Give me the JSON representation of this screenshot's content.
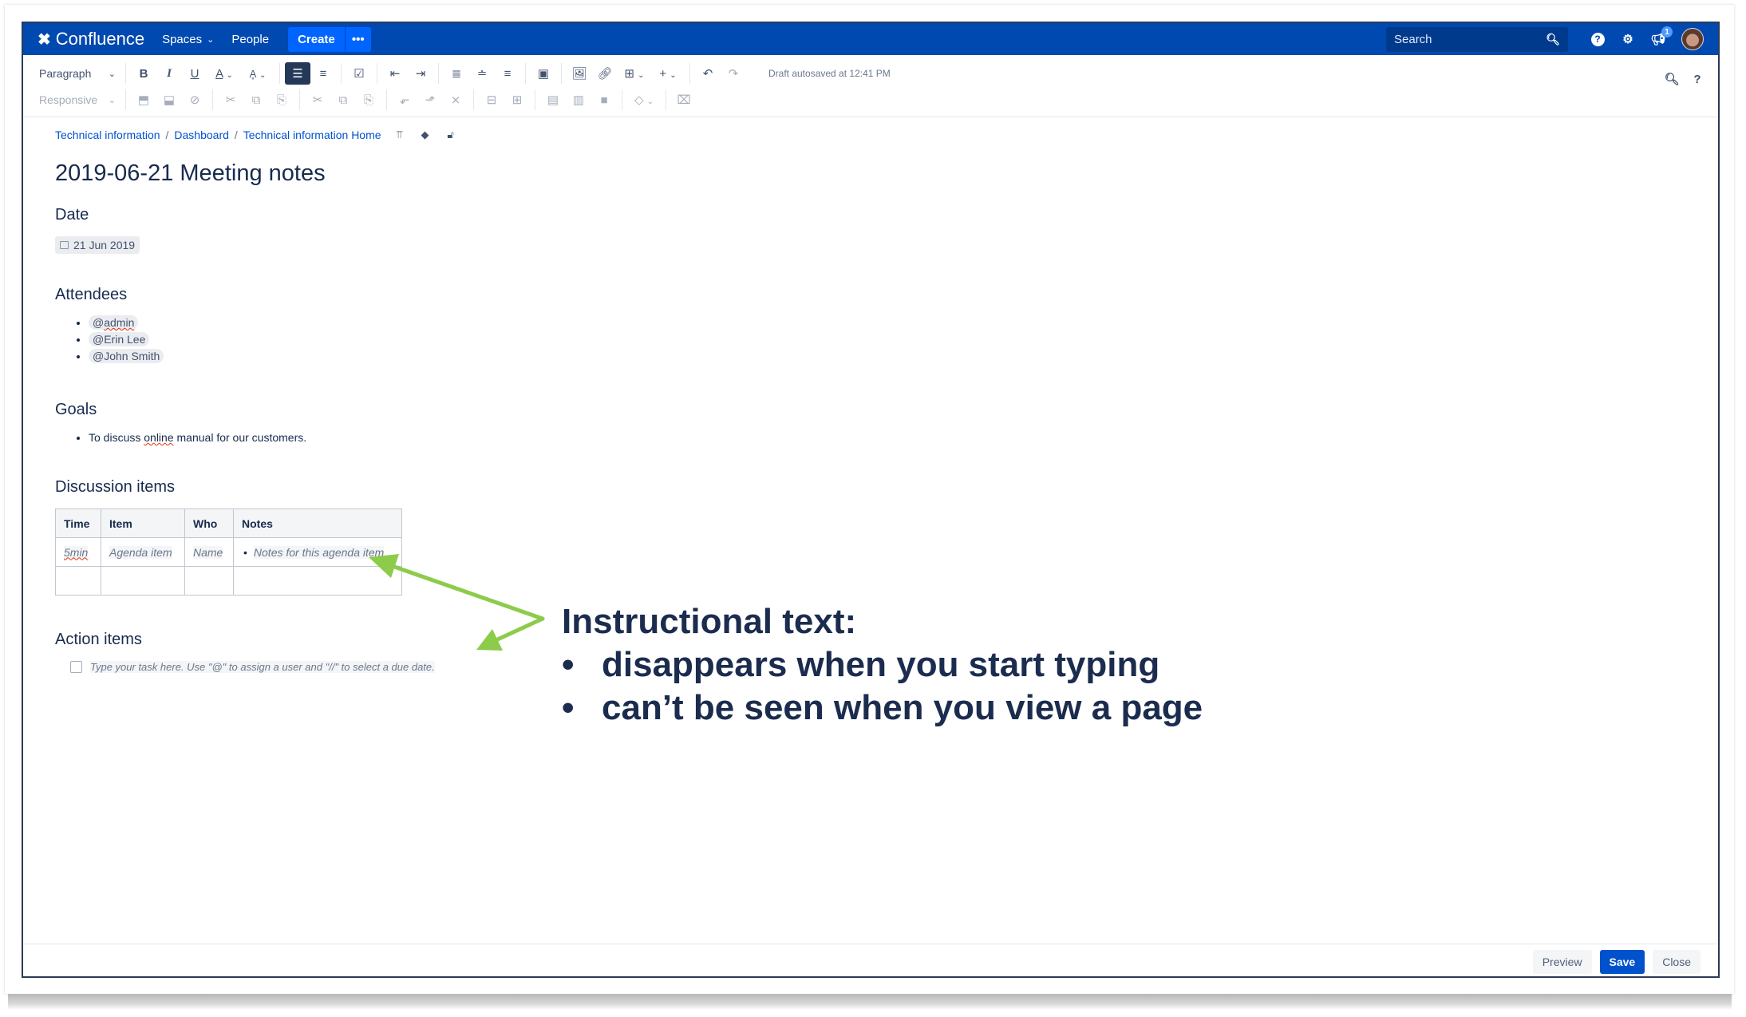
{
  "nav": {
    "logo": "Confluence",
    "spaces": "Spaces",
    "people": "People",
    "create": "Create",
    "more": "•••",
    "search_placeholder": "Search",
    "notification_count": "1"
  },
  "toolbar": {
    "paragraph_select": "Paragraph",
    "responsive_select": "Responsive",
    "draft_status": "Draft autosaved at 12:41 PM",
    "row1_icons": [
      "bold-icon",
      "italic-icon",
      "underline-icon",
      "text-color-icon",
      "clear-format-icon",
      "bullet-list-icon",
      "numbered-list-icon",
      "task-list-icon",
      "outdent-icon",
      "indent-icon",
      "align-left-icon",
      "align-center-icon",
      "align-right-icon",
      "layouts-icon",
      "image-icon",
      "link-icon",
      "table-icon",
      "insert-more-icon",
      "undo-icon",
      "redo-icon"
    ],
    "row2_icons": [
      "row-above-icon",
      "row-below-icon",
      "remove-row-icon",
      "cut-row-icon",
      "copy-row-icon",
      "paste-row-icon",
      "cut-column-icon",
      "copy-column-icon",
      "paste-column-icon",
      "column-before-icon",
      "column-after-icon",
      "remove-column-icon",
      "merge-cells-icon",
      "split-cells-icon",
      "heading-row-icon",
      "heading-column-icon",
      "numbered-column-icon",
      "cell-color-icon",
      "delete-table-icon"
    ]
  },
  "breadcrumb": [
    "Technical information",
    "Dashboard",
    "Technical information Home"
  ],
  "page": {
    "title": "2019-06-21 Meeting notes",
    "date_heading": "Date",
    "date_value": "21 Jun 2019",
    "attendees_heading": "Attendees",
    "attendees": [
      "admin",
      "Erin Lee",
      "John Smith"
    ],
    "goals_heading": "Goals",
    "goal_prefix": "To discuss ",
    "goal_spell": "online",
    "goal_suffix": " manual for our customers.",
    "discussion_heading": "Discussion items",
    "table": {
      "headers": [
        "Time",
        "Item",
        "Who",
        "Notes"
      ],
      "rows": [
        [
          "5min",
          "Agenda item",
          "Name",
          "Notes for this agenda item"
        ],
        [
          "",
          "",
          "",
          ""
        ]
      ]
    },
    "action_heading": "Action items",
    "task_placeholder": "Type your task here. Use \"@\" to assign a user and \"//\" to select a due date."
  },
  "footer": {
    "preview": "Preview",
    "save": "Save",
    "close": "Close"
  },
  "annotation": {
    "title": "Instructional text:",
    "items": [
      "disappears when you start typing",
      "can’t be seen when you view a page"
    ],
    "arrow_color": "#8DCB4B"
  }
}
